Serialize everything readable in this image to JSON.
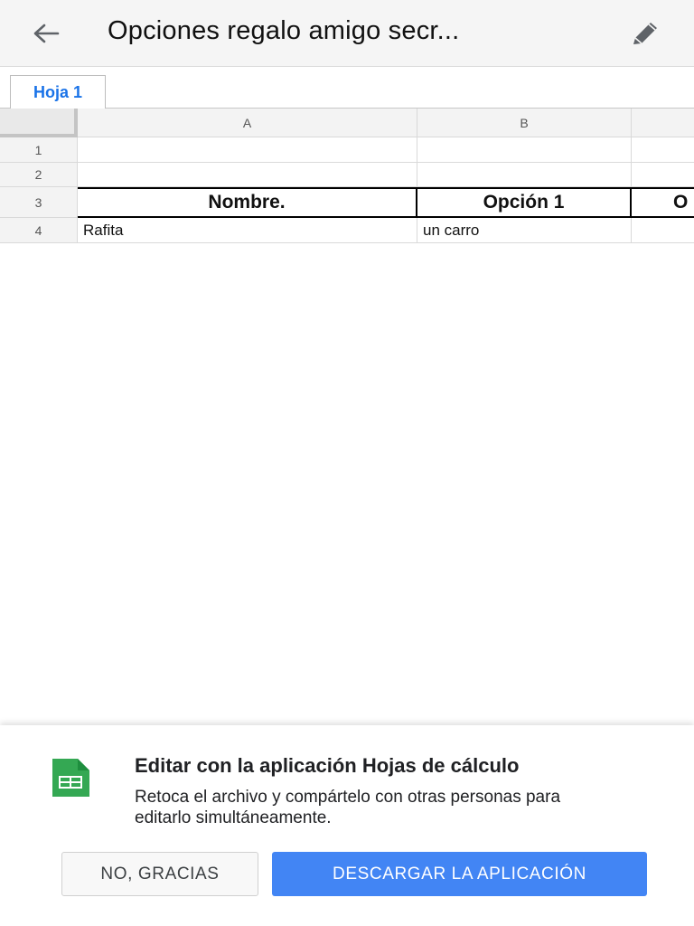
{
  "appbar": {
    "title": "Opciones regalo amigo secr...",
    "back_icon": "arrow-left-icon",
    "edit_icon": "pencil-icon"
  },
  "tabs": [
    {
      "label": "Hoja 1",
      "active": true
    }
  ],
  "sheet": {
    "column_headers": [
      "A",
      "B",
      ""
    ],
    "row_headers": [
      "1",
      "2",
      "3",
      "4"
    ],
    "rows": [
      [
        "",
        "",
        ""
      ],
      [
        "",
        "",
        ""
      ],
      [
        "Nombre.",
        "Opción 1",
        "O"
      ],
      [
        "Rafita",
        "un carro",
        ""
      ]
    ]
  },
  "promo": {
    "icon": "google-sheets-icon",
    "title": "Editar con la aplicación Hojas de cálculo",
    "description": "Retoca el archivo y compártelo con otras personas para editarlo simultáneamente.",
    "dismiss_label": "NO, GRACIAS",
    "download_label": "DESCARGAR LA APLICACIÓN"
  },
  "colors": {
    "accent": "#4285f4",
    "tab_text": "#1a73e8",
    "sheets_green": "#34a853"
  }
}
